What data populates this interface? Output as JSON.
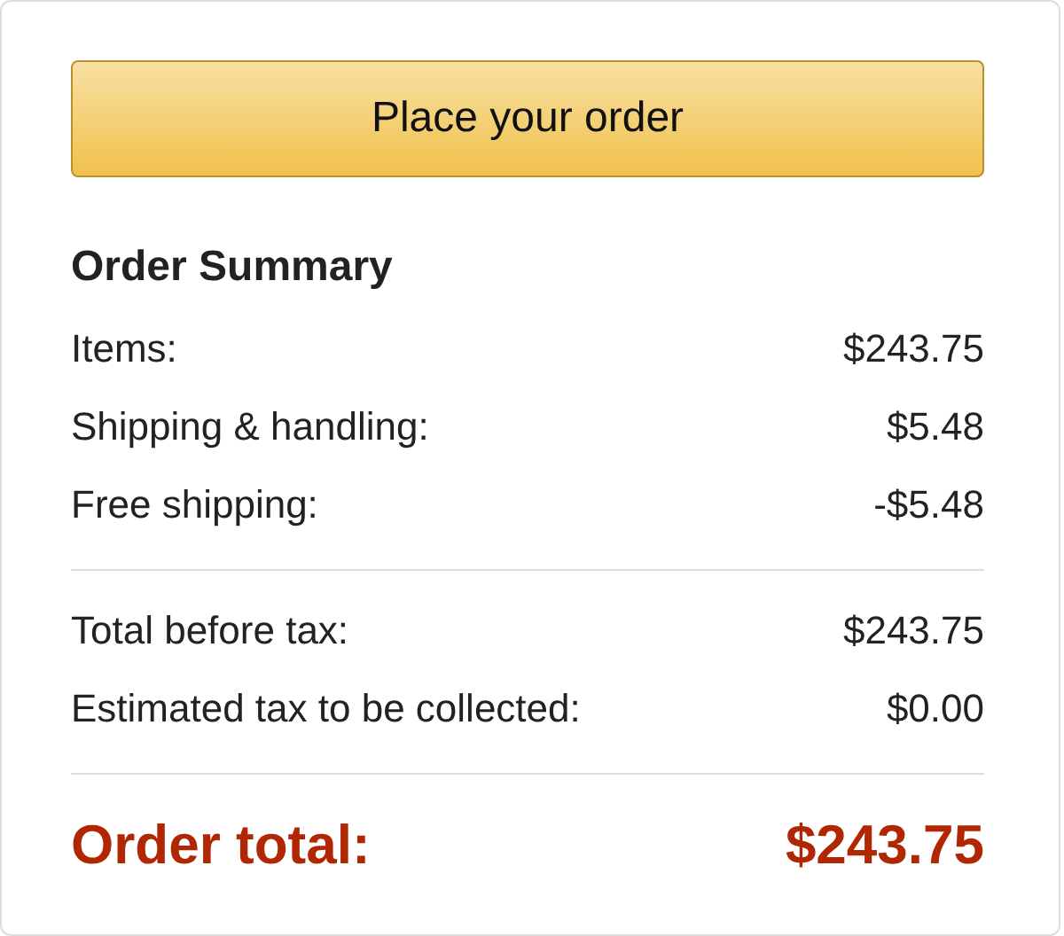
{
  "button": {
    "label": "Place your order"
  },
  "summary": {
    "title": "Order Summary",
    "sections": [
      {
        "rows": [
          {
            "label": "Items:",
            "value": "$243.75"
          },
          {
            "label": "Shipping & handling:",
            "value": "$5.48"
          },
          {
            "label": "Free shipping:",
            "value": "-$5.48"
          }
        ]
      },
      {
        "rows": [
          {
            "label": "Total before tax:",
            "value": "$243.75"
          },
          {
            "label": "Estimated tax to be collected:",
            "value": "$0.00"
          }
        ]
      }
    ],
    "total": {
      "label": "Order total:",
      "value": "$243.75"
    }
  }
}
